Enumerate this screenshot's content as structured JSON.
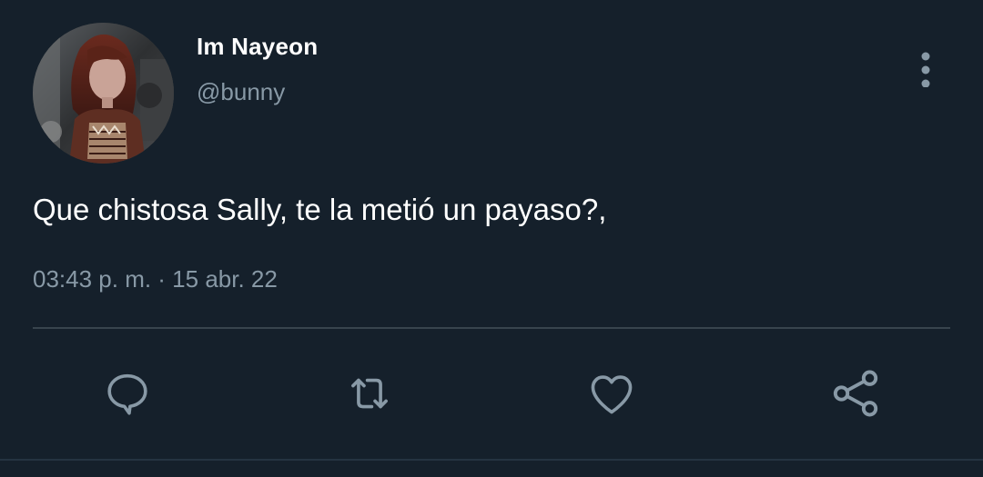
{
  "tweet": {
    "author": {
      "display_name": "Im Nayeon",
      "handle": "@bunny"
    },
    "text": "Que chistosa Sally, te la metió un payaso?,",
    "timestamp": "03:43 p. m. · 15 abr. 22"
  },
  "actions": [
    {
      "icon": "reply-icon"
    },
    {
      "icon": "retweet-icon"
    },
    {
      "icon": "like-icon"
    },
    {
      "icon": "share-icon"
    }
  ],
  "colors": {
    "background": "#15202b",
    "primary_text": "#ffffff",
    "secondary_text": "#8899a6",
    "divider": "#38444d",
    "icon": "#8899a6"
  }
}
